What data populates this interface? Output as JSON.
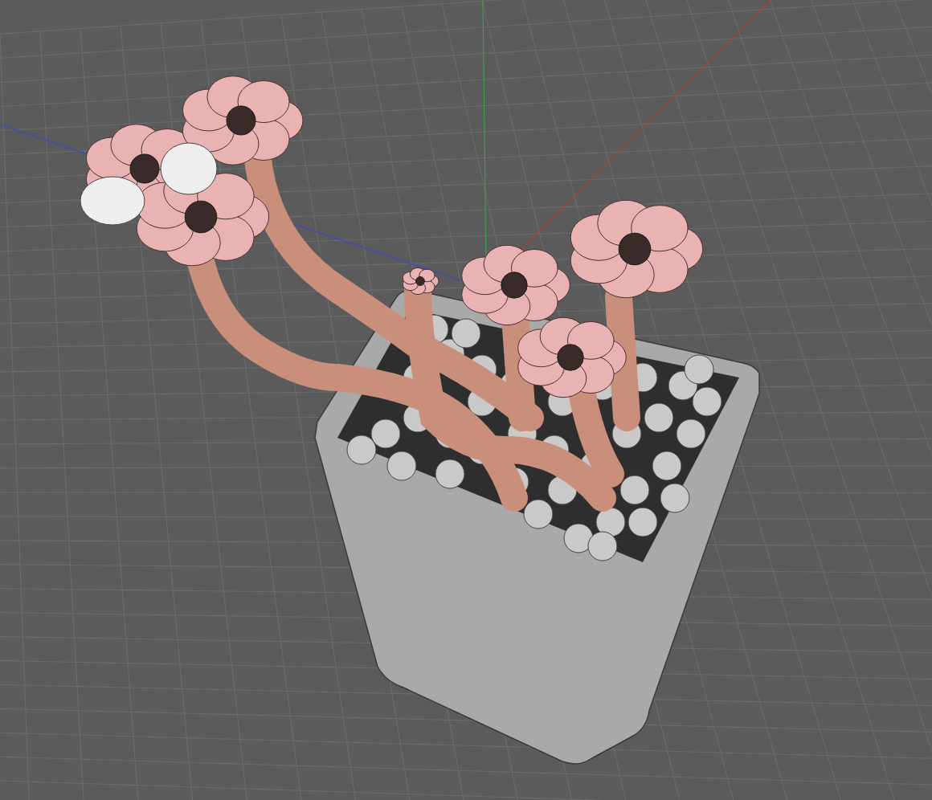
{
  "viewport": {
    "axes": [
      {
        "kind": "x",
        "color": "#c0392b"
      },
      {
        "kind": "y",
        "color": "#3f9e46"
      },
      {
        "kind": "z",
        "color": "#3a4bbf"
      }
    ]
  }
}
